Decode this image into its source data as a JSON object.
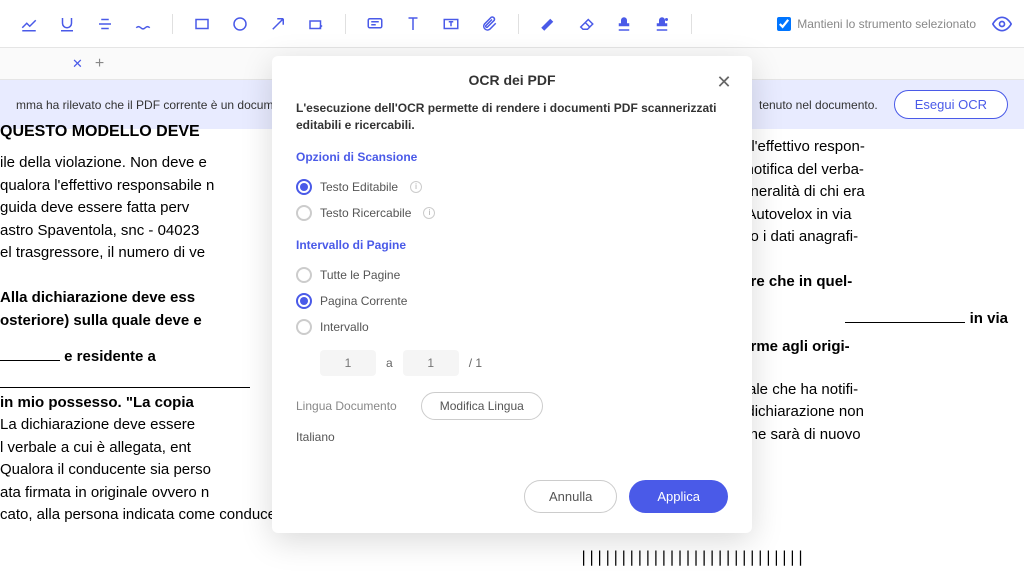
{
  "toolbar": {
    "keep_tool_label": "Mantieni lo strumento selezionato"
  },
  "banner": {
    "text_left": "mma ha rilevato che il PDF corrente è un docum",
    "text_right": "tenuto nel documento.",
    "button": "Esegui OCR"
  },
  "modal": {
    "title": "OCR dei PDF",
    "description": "L'esecuzione dell'OCR permette di rendere i documenti PDF scannerizzati editabili e ricercabili.",
    "scan_options_label": "Opzioni di Scansione",
    "opt_editable": "Testo Editabile",
    "opt_searchable": "Testo Ricercabile",
    "page_range_label": "Intervallo di Pagine",
    "range_all": "Tutte le Pagine",
    "range_current": "Pagina Corrente",
    "range_interval": "Intervallo",
    "interval_from": "1",
    "interval_sep": "a",
    "interval_to": "1",
    "interval_total": "/ 1",
    "lang_label": "Lingua Documento",
    "lang_button": "Modifica Lingua",
    "lang_value": "Italiano",
    "cancel": "Annulla",
    "apply": "Applica"
  },
  "document": {
    "title": "QUESTO MODELLO DEVE",
    "l1": "ile della violazione. Non deve e",
    "l2": "qualora l'effettivo responsabile n",
    "l3": " guida deve essere fatta perv",
    "l4": "astro Spaventola, snc - 04023",
    "l5": "el trasgressore, il numero di ve",
    "l6": "Alla dichiarazione deve ess",
    "l7": "osteriore) sulla quale deve e",
    "l8": "e residente a",
    "l9": "in mio possesso. \"La copia",
    "l10": "La dichiarazione deve essere",
    "l11": "l verbale a cui è allegata, ent",
    "l12": "Qualora il conducente sia perso",
    "l13": "ata firmata in originale ovvero n",
    "l14": "cato, alla persona indicata come conducente, con spese interamente a suo carico.",
    "r1": "sere l'effettivo respon-",
    "r2": "ella notifica del verba-",
    "r3": "le generalità di chi era",
    "r4": "one Autovelox in via",
    "r5": "cendo i dati anagrafi-",
    "r6": "teriore che in quel-",
    "r7": "in via",
    "r8": "onforme agli origi-",
    "r9": "vinciale che ha notifi-",
    "r10": "e la dichiarazione non",
    "r11": "tazione sarà di nuovo",
    "barcode": "||||||||||||||||||||||||||||"
  }
}
